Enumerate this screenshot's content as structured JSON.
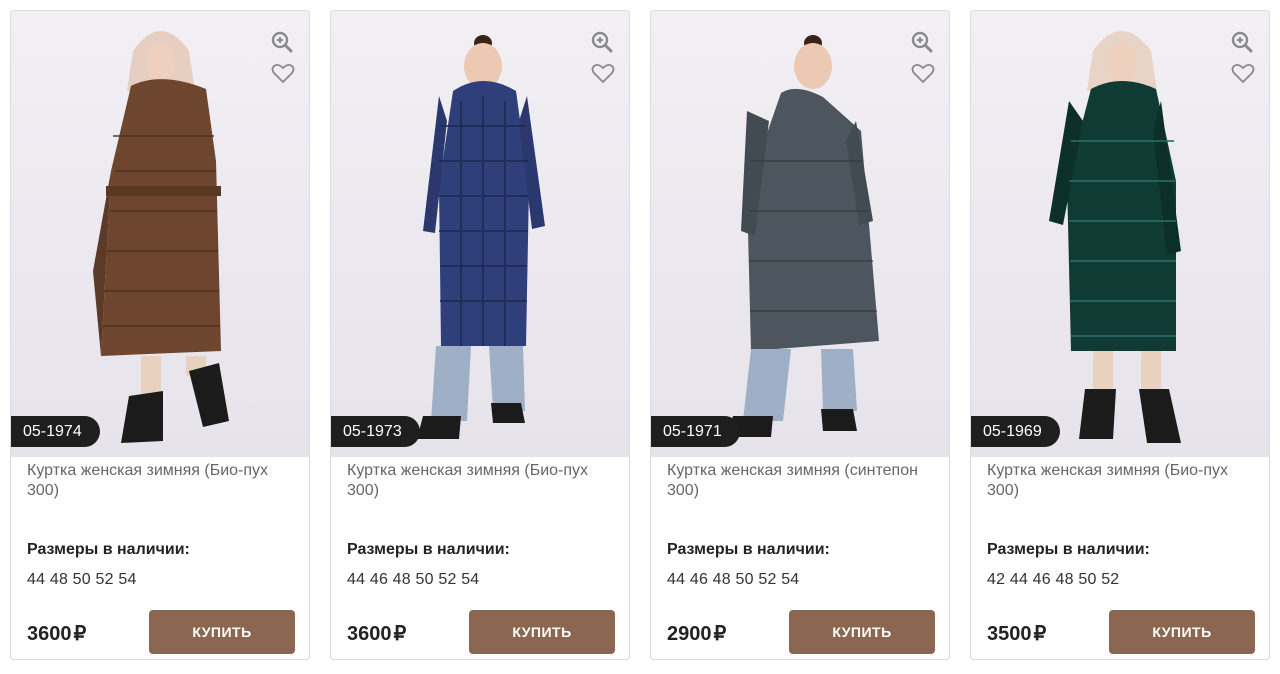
{
  "products": [
    {
      "sku": "05-1974",
      "title": "Куртка женская зимняя (Био-пух 300)",
      "sizes_label": "Размеры в наличии:",
      "sizes": "44 48 50 52 54",
      "price": "3600",
      "currency": "₽",
      "buy_label": "КУПИТЬ",
      "coat_color": "#6e4630",
      "hood_color": "#e6cfc0"
    },
    {
      "sku": "05-1973",
      "title": "Куртка женская зимняя (Био-пух 300)",
      "sizes_label": "Размеры в наличии:",
      "sizes": "44 46 48 50 52 54",
      "price": "3600",
      "currency": "₽",
      "buy_label": "КУПИТЬ",
      "coat_color": "#2f3f7a",
      "hood_color": "#2f3f7a"
    },
    {
      "sku": "05-1971",
      "title": "Куртка женская зимняя (синтепон 300)",
      "sizes_label": "Размеры в наличии:",
      "sizes": "44 46 48 50 52 54",
      "price": "2900",
      "currency": "₽",
      "buy_label": "КУПИТЬ",
      "coat_color": "#4d565e",
      "hood_color": "#4d565e"
    },
    {
      "sku": "05-1969",
      "title": "Куртка женская зимняя (Био-пух 300)",
      "sizes_label": "Размеры в наличии:",
      "sizes": "42 44 46 48 50 52",
      "price": "3500",
      "currency": "₽",
      "buy_label": "КУПИТЬ",
      "coat_color": "#0f3b34",
      "hood_color": "#e8d4c6"
    }
  ],
  "icons": {
    "zoom": "zoom-in-icon",
    "favorite": "heart-icon"
  },
  "colors": {
    "button_bg": "#8b6650",
    "sku_badge_bg": "#1e1e1e"
  }
}
